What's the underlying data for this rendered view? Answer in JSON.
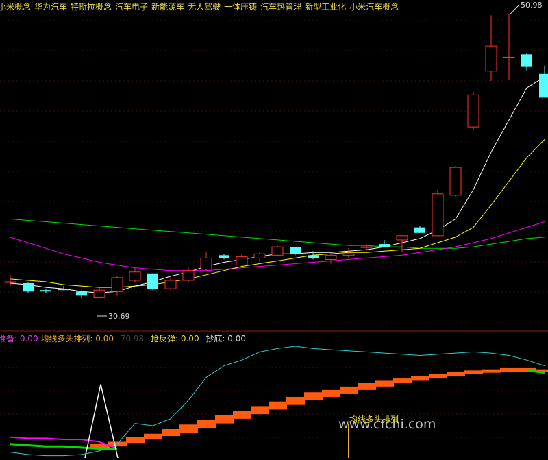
{
  "concepts": [
    "小米概念",
    "华为汽车",
    "特斯拉概念",
    "汽车电子",
    "新能源车",
    "无人驾驶",
    "一体压铸",
    "汽车热管理",
    "新型工业化",
    "小米汽车概念"
  ],
  "sub_legend": {
    "item1": "准备: 0.00",
    "item2": "均线多头排列: 0.00",
    "item3": "70.98",
    "item4": "抢反弹: 0.00",
    "item5": "抄底: 0.00"
  },
  "price_high_label": "50.98",
  "price_low_label": "30.69",
  "signal_label": "均线多头排列",
  "watermark": "www.cfchi.com",
  "colors": {
    "up": "#ff3333",
    "down": "#54fcfc",
    "ma5": "#ffffff",
    "ma10": "#ffff00",
    "ma_magenta": "#ff00ff",
    "ma_green": "#00dd00",
    "cyan_line": "#33cccc",
    "ribbon": "#ff5a10"
  },
  "chart_data": [
    {
      "type": "candlestick",
      "title": "",
      "ylim": [
        29,
        52
      ],
      "candles": [
        {
          "o": 31.9,
          "h": 32.4,
          "l": 31.6,
          "c": 31.9
        },
        {
          "o": 31.8,
          "h": 31.9,
          "l": 31.1,
          "c": 31.2
        },
        {
          "o": 31.3,
          "h": 31.4,
          "l": 31.1,
          "c": 31.2
        },
        {
          "o": 31.4,
          "h": 31.6,
          "l": 31.3,
          "c": 31.3
        },
        {
          "o": 31.2,
          "h": 31.3,
          "l": 30.7,
          "c": 30.9
        },
        {
          "o": 30.8,
          "h": 31.5,
          "l": 30.69,
          "c": 31.3
        },
        {
          "o": 31.2,
          "h": 32.3,
          "l": 30.9,
          "c": 32.2
        },
        {
          "o": 32.0,
          "h": 32.9,
          "l": 31.9,
          "c": 32.6
        },
        {
          "o": 32.5,
          "h": 32.5,
          "l": 31.3,
          "c": 31.4
        },
        {
          "o": 31.4,
          "h": 32.2,
          "l": 31.3,
          "c": 32.0
        },
        {
          "o": 32.0,
          "h": 32.9,
          "l": 31.9,
          "c": 32.7
        },
        {
          "o": 32.8,
          "h": 34.0,
          "l": 32.7,
          "c": 33.6
        },
        {
          "o": 33.8,
          "h": 33.9,
          "l": 33.5,
          "c": 33.6
        },
        {
          "o": 33.1,
          "h": 33.9,
          "l": 32.9,
          "c": 33.7
        },
        {
          "o": 33.6,
          "h": 34.0,
          "l": 33.4,
          "c": 33.9
        },
        {
          "o": 33.8,
          "h": 34.5,
          "l": 33.7,
          "c": 34.4
        },
        {
          "o": 34.4,
          "h": 34.4,
          "l": 33.8,
          "c": 33.9
        },
        {
          "o": 33.8,
          "h": 34.1,
          "l": 33.5,
          "c": 33.6
        },
        {
          "o": 33.5,
          "h": 33.9,
          "l": 33.2,
          "c": 33.8
        },
        {
          "o": 33.8,
          "h": 34.3,
          "l": 33.6,
          "c": 33.9
        },
        {
          "o": 34.4,
          "h": 34.6,
          "l": 34.2,
          "c": 34.4
        },
        {
          "o": 34.6,
          "h": 34.9,
          "l": 34.5,
          "c": 34.4
        },
        {
          "o": 34.9,
          "h": 35.2,
          "l": 34.0,
          "c": 35.2
        },
        {
          "o": 35.8,
          "h": 35.9,
          "l": 35.4,
          "c": 35.4
        },
        {
          "o": 35.2,
          "h": 38.5,
          "l": 35.2,
          "c": 38.2
        },
        {
          "o": 38.1,
          "h": 40.2,
          "l": 38.0,
          "c": 40.1
        },
        {
          "o": 43.0,
          "h": 45.5,
          "l": 42.8,
          "c": 45.3
        },
        {
          "o": 47.0,
          "h": 51.0,
          "l": 46.3,
          "c": 48.8
        },
        {
          "o": 48.0,
          "h": 51.1,
          "l": 46.4,
          "c": 48.0
        },
        {
          "o": 48.2,
          "h": 48.3,
          "l": 47.0,
          "c": 47.3
        },
        {
          "o": 46.8,
          "h": 47.4,
          "l": 45.7,
          "c": 45.1
        }
      ],
      "ma_white": [
        31.8,
        31.7,
        31.5,
        31.4,
        31.2,
        31.1,
        31.2,
        31.6,
        31.9,
        32.3,
        32.6,
        33.0,
        33.3,
        33.5,
        33.7,
        33.9,
        33.9,
        34.0,
        34.0,
        34.1,
        34.2,
        34.4,
        34.7,
        35.0,
        35.6,
        36.4,
        38.5,
        41.2,
        43.5,
        45.8,
        46.6
      ],
      "ma_yellow": [
        32.1,
        32.0,
        31.9,
        31.7,
        31.6,
        31.5,
        31.5,
        31.6,
        31.7,
        31.9,
        32.1,
        32.4,
        32.7,
        33.0,
        33.2,
        33.4,
        33.6,
        33.8,
        33.9,
        34.0,
        34.0,
        34.1,
        34.2,
        34.3,
        34.7,
        35.1,
        35.8,
        37.4,
        39.1,
        40.8,
        42.1
      ],
      "ma_magenta": [
        35.1,
        34.7,
        34.3,
        33.9,
        33.6,
        33.3,
        33.1,
        32.9,
        32.8,
        32.7,
        32.7,
        32.7,
        32.8,
        32.9,
        33.0,
        33.1,
        33.2,
        33.3,
        33.4,
        33.5,
        33.6,
        33.7,
        33.8,
        34.0,
        34.2,
        34.4,
        34.7,
        35.0,
        35.4,
        35.8,
        36.2
      ],
      "ma_green": [
        36.4,
        36.3,
        36.2,
        36.1,
        36.0,
        35.9,
        35.8,
        35.7,
        35.6,
        35.5,
        35.4,
        35.3,
        35.2,
        35.1,
        35.0,
        34.9,
        34.8,
        34.7,
        34.6,
        34.5,
        34.5,
        34.4,
        34.4,
        34.3,
        34.3,
        34.3,
        34.4,
        34.6,
        34.8,
        35.0,
        35.1
      ]
    },
    {
      "type": "line",
      "title": "",
      "ylim": [
        0,
        100
      ],
      "cyan_line": [
        5,
        3,
        2,
        2,
        3,
        6,
        12,
        30,
        28,
        34,
        50,
        70,
        80,
        85,
        92,
        95,
        97,
        95,
        94,
        93,
        92,
        91,
        90,
        89,
        90,
        91,
        92,
        91,
        89,
        85,
        80
      ],
      "ribbon": [
        [
          6,
          10
        ],
        [
          6,
          10
        ],
        [
          6,
          10
        ],
        [
          6,
          10
        ],
        [
          6,
          10
        ],
        [
          8,
          12
        ],
        [
          10,
          14
        ],
        [
          13,
          18
        ],
        [
          16,
          21
        ],
        [
          19,
          25
        ],
        [
          22,
          29
        ],
        [
          26,
          33
        ],
        [
          30,
          37
        ],
        [
          34,
          41
        ],
        [
          38,
          45
        ],
        [
          42,
          49
        ],
        [
          46,
          53
        ],
        [
          50,
          57
        ],
        [
          53,
          59
        ],
        [
          56,
          62
        ],
        [
          59,
          65
        ],
        [
          62,
          67
        ],
        [
          65,
          69
        ],
        [
          67,
          71
        ],
        [
          69,
          73
        ],
        [
          71,
          75
        ],
        [
          73,
          76
        ],
        [
          74,
          77
        ],
        [
          75,
          78
        ],
        [
          75,
          78
        ],
        [
          75,
          77
        ]
      ],
      "green_line": [
        12,
        11,
        10,
        10,
        9,
        8,
        8,
        8,
        8,
        8,
        8,
        8,
        8,
        8,
        8,
        8,
        8,
        8,
        8,
        8,
        8,
        8,
        8,
        8,
        8,
        8,
        8,
        8,
        8,
        76,
        74
      ],
      "magenta_line": [
        18,
        17,
        17,
        16,
        16,
        14,
        8,
        8,
        8,
        8,
        8,
        8,
        8,
        8,
        8,
        8,
        8,
        8,
        8,
        8,
        8,
        8,
        8,
        8,
        8,
        8,
        8,
        8,
        8,
        8,
        8
      ],
      "triangle_peak": 64,
      "signal_bar_index": 19,
      "signal_bar_value": 30
    }
  ]
}
